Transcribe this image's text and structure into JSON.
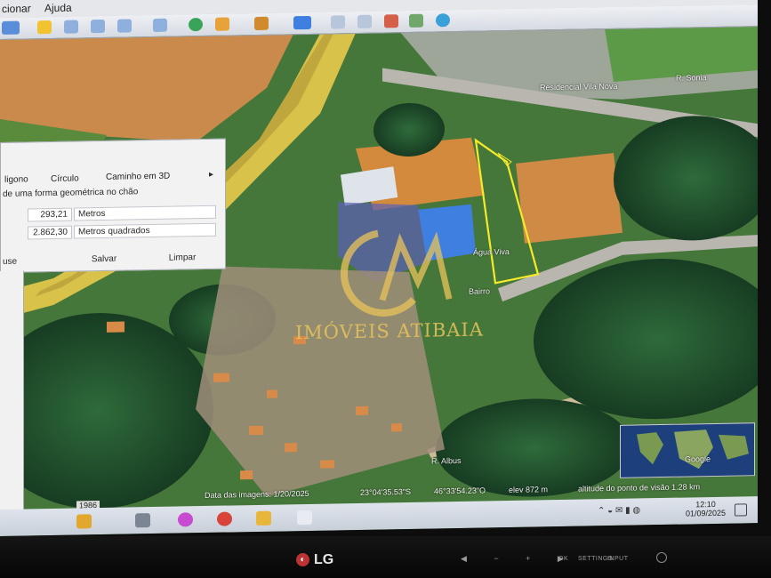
{
  "menu": {
    "item_1": "cionar",
    "item_2": "Ajuda"
  },
  "measure_panel": {
    "tabs": [
      "ligono",
      "Círculo",
      "Caminho em 3D"
    ],
    "hint": "de uma forma geométrica no chão",
    "length_value": "293,21",
    "length_unit": "Metros",
    "area_value": "2.862,30",
    "area_unit": "Metros quadrados",
    "mouse_label": "use",
    "save_label": "Salvar",
    "clear_label": "Limpar"
  },
  "map_labels": {
    "residencial": "Residencial Vila Nova",
    "road": "R. Sonia",
    "agua_viva": "Água Viva",
    "street": "R. Albus",
    "street_2": "Bairro"
  },
  "watermark": {
    "brand_text": "IMÓVEIS ATIBAIA",
    "logo_letters": "GM"
  },
  "status_bar": {
    "imagery_date": "Data das imagens: 1/20/2025",
    "latitude": "23°04'35.53\"S",
    "longitude": "46°33'54.23\"O",
    "elevation": "elev   872 m",
    "eye_altitude": "altitude do ponto de visão   1.28 km",
    "year": "1986",
    "google": "Google"
  },
  "taskbar": {
    "time": "12:10",
    "date": "01/09/2025"
  },
  "monitor": {
    "brand": "LG",
    "buttons": [
      "OK",
      "SETTINGS",
      "INPUT"
    ]
  }
}
